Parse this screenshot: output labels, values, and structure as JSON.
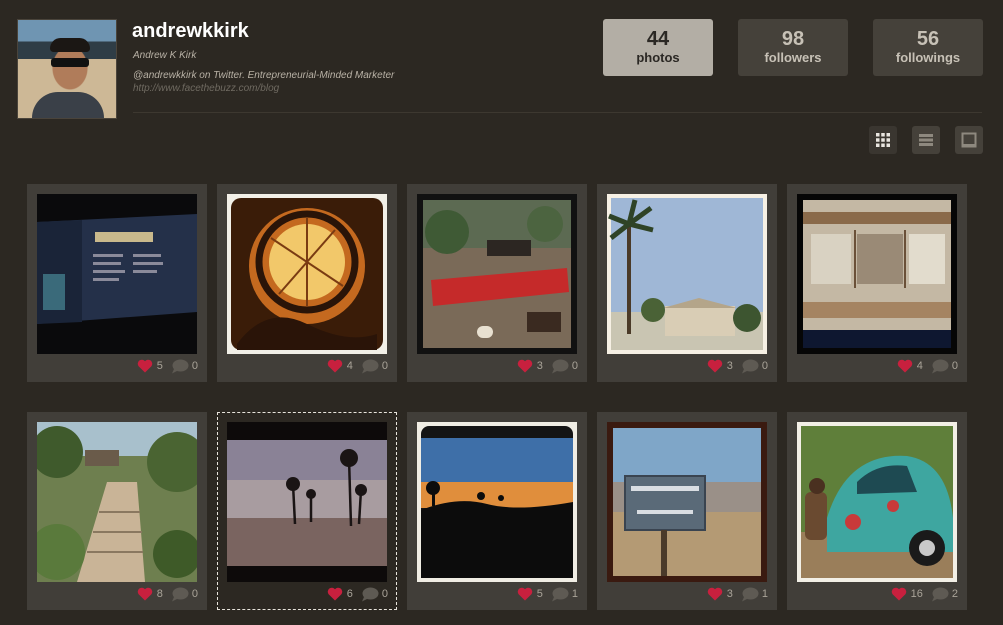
{
  "profile": {
    "username": "andrewkkirk",
    "full_name": "Andrew K Kirk",
    "bio": "@andrewkkirk on Twitter. Entrepreneurial-Minded Marketer",
    "website": "http://www.facethebuzz.com/blog"
  },
  "stats": [
    {
      "count": "44",
      "label": "photos",
      "active": true
    },
    {
      "count": "98",
      "label": "followers",
      "active": false
    },
    {
      "count": "56",
      "label": "followings",
      "active": false
    }
  ],
  "view_toggles": [
    {
      "icon": "grid-view-icon",
      "active": true
    },
    {
      "icon": "list-view-icon",
      "active": false
    },
    {
      "icon": "single-view-icon",
      "active": false
    }
  ],
  "photos": [
    {
      "likes": "5",
      "comments": "0"
    },
    {
      "likes": "4",
      "comments": "0"
    },
    {
      "likes": "3",
      "comments": "0"
    },
    {
      "likes": "3",
      "comments": "0"
    },
    {
      "likes": "4",
      "comments": "0"
    },
    {
      "likes": "8",
      "comments": "0"
    },
    {
      "likes": "6",
      "comments": "0"
    },
    {
      "likes": "5",
      "comments": "1"
    },
    {
      "likes": "3",
      "comments": "1"
    },
    {
      "likes": "16",
      "comments": "2"
    }
  ],
  "colors": {
    "background": "#2c2822",
    "card": "#413e39",
    "heart": "#c8203e",
    "stat_active": "#b3aea5"
  }
}
